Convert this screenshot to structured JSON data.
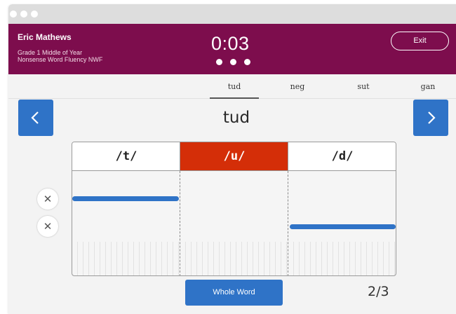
{
  "header": {
    "student_name": "Eric Mathews",
    "grade_line": "Grade 1  Middle of Year",
    "test_line": "Nonsense Word Fluency  NWF",
    "timer": "0:03",
    "timer_dots": 3,
    "exit_label": "Exit"
  },
  "word_tabs": [
    {
      "label": "tud",
      "active": true
    },
    {
      "label": "neg",
      "active": false
    },
    {
      "label": "sut",
      "active": false
    },
    {
      "label": "gan",
      "active": false
    }
  ],
  "current_word": "tud",
  "phonemes": [
    {
      "label": "/t/",
      "selected": false,
      "bar_level": "top"
    },
    {
      "label": "/u/",
      "selected": true,
      "bar_level": "none"
    },
    {
      "label": "/d/",
      "selected": false,
      "bar_level": "bottom"
    }
  ],
  "whole_word_label": "Whole Word",
  "progress": "2/3",
  "colors": {
    "header_bg": "#7d0d4d",
    "accent_blue": "#2f73c7",
    "selected_red": "#d42e08"
  },
  "icons": {
    "prev": "chevron-left-icon",
    "next": "chevron-right-icon",
    "clear": "close-icon"
  }
}
